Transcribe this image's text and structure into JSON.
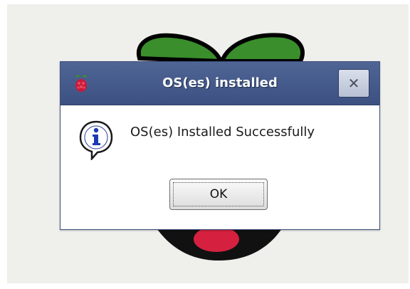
{
  "dialog": {
    "title": "OS(es) installed",
    "message": "OS(es) Installed Successfully",
    "ok_label": "OK",
    "close_label": "✕",
    "icon": "info-icon"
  },
  "colors": {
    "titlebar": "#4a5f8f",
    "background": "#efefec",
    "leaf_green": "#3a8e2c",
    "berry_red": "#d5213f"
  }
}
